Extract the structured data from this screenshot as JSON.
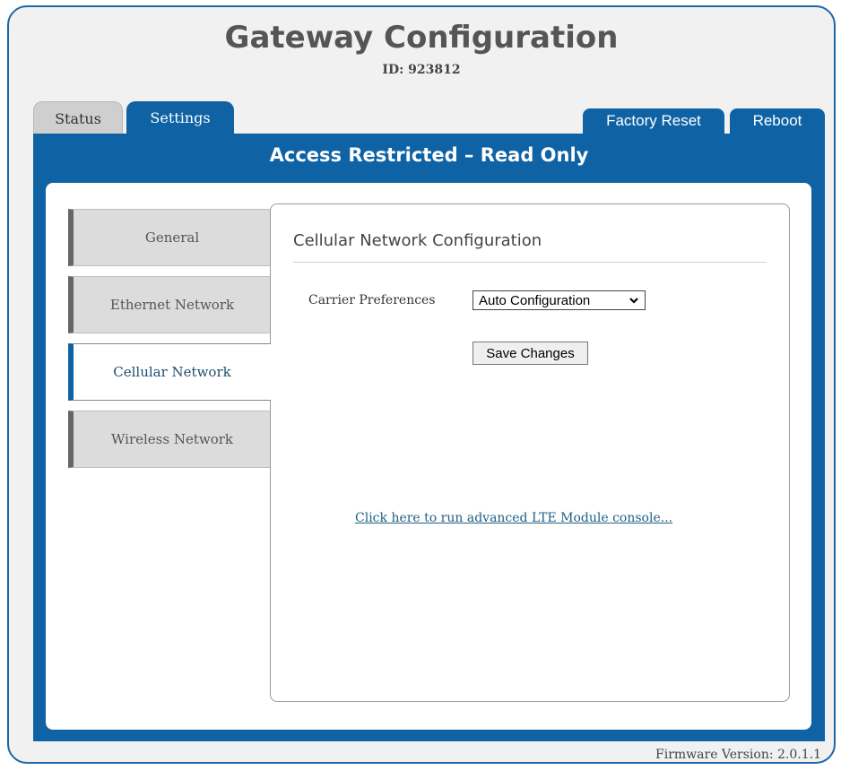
{
  "header": {
    "title": "Gateway Configuration",
    "id_text": "ID: 923812"
  },
  "tabs": [
    {
      "label": "Status",
      "active": false
    },
    {
      "label": "Settings",
      "active": true
    }
  ],
  "actions": {
    "factory_reset": "Factory Reset",
    "reboot": "Reboot"
  },
  "banner": "Access Restricted – Read Only",
  "nav": [
    {
      "label": "General",
      "active": false
    },
    {
      "label": "Ethernet Network",
      "active": false
    },
    {
      "label": "Cellular Network",
      "active": true
    },
    {
      "label": "Wireless Network",
      "active": false
    }
  ],
  "section": {
    "title": "Cellular Network Configuration",
    "carrier_label": "Carrier Preferences",
    "carrier_value": "Auto Configuration",
    "save_label": "Save Changes",
    "console_link": "Click here to run advanced LTE Module console..."
  },
  "footer": {
    "firmware": "Firmware Version: 2.0.1.1"
  },
  "colors": {
    "accent": "#0f63a5",
    "frame_border": "#1b67a8",
    "page_bg": "#f1f1f1",
    "link": "#1f5f82"
  },
  "icons": {
    "select_chevron": "chevron-down-icon"
  }
}
